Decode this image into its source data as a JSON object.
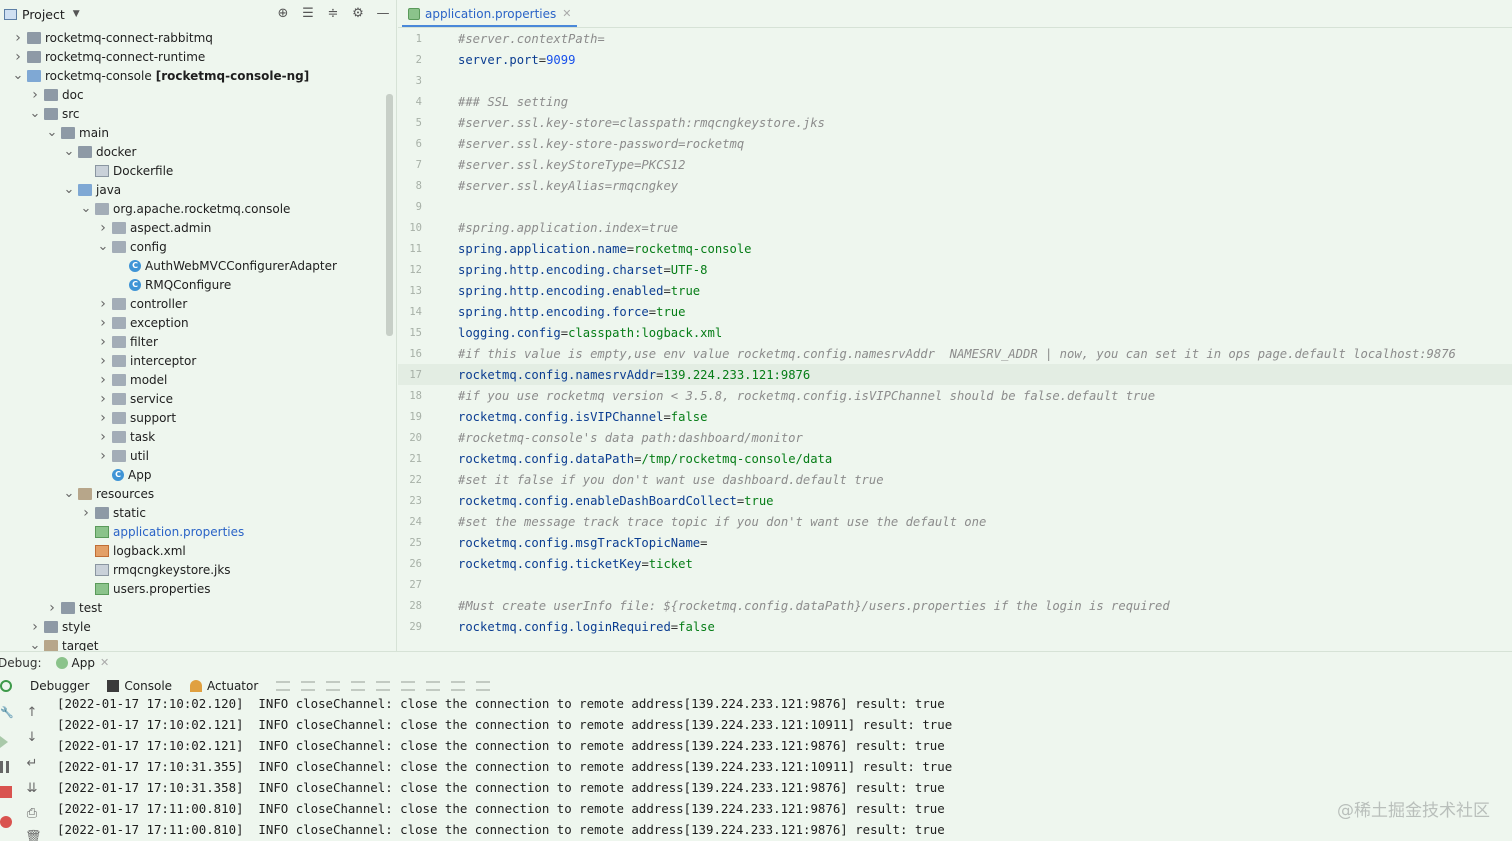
{
  "project": {
    "label": "Project",
    "tree": [
      {
        "label": "rocketmq-connect-rabbitmq",
        "depth": 0,
        "arrow": "right",
        "icon": "folder"
      },
      {
        "label": "rocketmq-connect-runtime",
        "depth": 0,
        "arrow": "right",
        "icon": "folder"
      },
      {
        "label": "rocketmq-console",
        "bold": "[rocketmq-console-ng]",
        "depth": 0,
        "arrow": "down",
        "icon": "module"
      },
      {
        "label": "doc",
        "depth": 1,
        "arrow": "right",
        "icon": "folder"
      },
      {
        "label": "src",
        "depth": 1,
        "arrow": "down",
        "icon": "folder"
      },
      {
        "label": "main",
        "depth": 2,
        "arrow": "down",
        "icon": "folder"
      },
      {
        "label": "docker",
        "depth": 3,
        "arrow": "down",
        "icon": "folder"
      },
      {
        "label": "Dockerfile",
        "depth": 4,
        "arrow": "",
        "icon": "file"
      },
      {
        "label": "java",
        "depth": 3,
        "arrow": "down",
        "icon": "folder-blue"
      },
      {
        "label": "org.apache.rocketmq.console",
        "depth": 4,
        "arrow": "down",
        "icon": "package"
      },
      {
        "label": "aspect.admin",
        "depth": 5,
        "arrow": "right",
        "icon": "package"
      },
      {
        "label": "config",
        "depth": 5,
        "arrow": "down",
        "icon": "package"
      },
      {
        "label": "AuthWebMVCConfigurerAdapter",
        "depth": 6,
        "arrow": "",
        "icon": "class"
      },
      {
        "label": "RMQConfigure",
        "depth": 6,
        "arrow": "",
        "icon": "class"
      },
      {
        "label": "controller",
        "depth": 5,
        "arrow": "right",
        "icon": "package"
      },
      {
        "label": "exception",
        "depth": 5,
        "arrow": "right",
        "icon": "package"
      },
      {
        "label": "filter",
        "depth": 5,
        "arrow": "right",
        "icon": "package"
      },
      {
        "label": "interceptor",
        "depth": 5,
        "arrow": "right",
        "icon": "package"
      },
      {
        "label": "model",
        "depth": 5,
        "arrow": "right",
        "icon": "package"
      },
      {
        "label": "service",
        "depth": 5,
        "arrow": "right",
        "icon": "package"
      },
      {
        "label": "support",
        "depth": 5,
        "arrow": "right",
        "icon": "package"
      },
      {
        "label": "task",
        "depth": 5,
        "arrow": "right",
        "icon": "package"
      },
      {
        "label": "util",
        "depth": 5,
        "arrow": "right",
        "icon": "package"
      },
      {
        "label": "App",
        "depth": 5,
        "arrow": "",
        "icon": "class"
      },
      {
        "label": "resources",
        "depth": 3,
        "arrow": "down",
        "icon": "folder-res"
      },
      {
        "label": "static",
        "depth": 4,
        "arrow": "right",
        "icon": "folder"
      },
      {
        "label": "application.properties",
        "depth": 4,
        "arrow": "",
        "icon": "props",
        "highlight": true
      },
      {
        "label": "logback.xml",
        "depth": 4,
        "arrow": "",
        "icon": "xml"
      },
      {
        "label": "rmqcngkeystore.jks",
        "depth": 4,
        "arrow": "",
        "icon": "file"
      },
      {
        "label": "users.properties",
        "depth": 4,
        "arrow": "",
        "icon": "props"
      },
      {
        "label": "test",
        "depth": 2,
        "arrow": "right",
        "icon": "folder"
      },
      {
        "label": "style",
        "depth": 1,
        "arrow": "right",
        "icon": "folder"
      },
      {
        "label": "target",
        "depth": 1,
        "arrow": "down",
        "icon": "folder-res"
      }
    ]
  },
  "editor": {
    "tab_label": "application.properties",
    "current_line": 17,
    "lines": [
      {
        "n": "1",
        "type": "comment",
        "text": "#server.contextPath="
      },
      {
        "n": "2",
        "type": "kv",
        "key": "server.port",
        "value": "9099",
        "vtype": "num"
      },
      {
        "n": "3",
        "type": "blank",
        "text": ""
      },
      {
        "n": "4",
        "type": "comment",
        "text": "### SSL setting"
      },
      {
        "n": "5",
        "type": "comment",
        "text": "#server.ssl.key-store=classpath:rmqcngkeystore.jks"
      },
      {
        "n": "6",
        "type": "comment",
        "text": "#server.ssl.key-store-password=rocketmq"
      },
      {
        "n": "7",
        "type": "comment",
        "text": "#server.ssl.keyStoreType=PKCS12"
      },
      {
        "n": "8",
        "type": "comment",
        "text": "#server.ssl.keyAlias=rmqcngkey"
      },
      {
        "n": "9",
        "type": "blank",
        "text": ""
      },
      {
        "n": "10",
        "type": "comment",
        "text": "#spring.application.index=true"
      },
      {
        "n": "11",
        "type": "kv",
        "key": "spring.application.name",
        "value": "rocketmq-console",
        "vtype": "val"
      },
      {
        "n": "12",
        "type": "kv",
        "key": "spring.http.encoding.charset",
        "value": "UTF-8",
        "vtype": "val"
      },
      {
        "n": "13",
        "type": "kv",
        "key": "spring.http.encoding.enabled",
        "value": "true",
        "vtype": "val"
      },
      {
        "n": "14",
        "type": "kv",
        "key": "spring.http.encoding.force",
        "value": "true",
        "vtype": "val"
      },
      {
        "n": "15",
        "type": "kv",
        "key": "logging.config",
        "value": "classpath:logback.xml",
        "vtype": "val"
      },
      {
        "n": "16",
        "type": "comment",
        "text": "#if this value is empty,use env value rocketmq.config.namesrvAddr  NAMESRV_ADDR | now, you can set it in ops page.default localhost:9876"
      },
      {
        "n": "17",
        "type": "kv",
        "key": "rocketmq.config.namesrvAddr",
        "value": "139.224.233.121:9876",
        "vtype": "val"
      },
      {
        "n": "18",
        "type": "comment",
        "text": "#if you use rocketmq version < 3.5.8, rocketmq.config.isVIPChannel should be false.default true"
      },
      {
        "n": "19",
        "type": "kv",
        "key": "rocketmq.config.isVIPChannel",
        "value": "false",
        "vtype": "val"
      },
      {
        "n": "20",
        "type": "comment",
        "text": "#rocketmq-console's data path:dashboard/monitor"
      },
      {
        "n": "21",
        "type": "kv",
        "key": "rocketmq.config.dataPath",
        "value": "/tmp/rocketmq-console/data",
        "vtype": "val"
      },
      {
        "n": "22",
        "type": "comment",
        "text": "#set it false if you don't want use dashboard.default true"
      },
      {
        "n": "23",
        "type": "kv",
        "key": "rocketmq.config.enableDashBoardCollect",
        "value": "true",
        "vtype": "val"
      },
      {
        "n": "24",
        "type": "comment",
        "text": "#set the message track trace topic if you don't want use the default one"
      },
      {
        "n": "25",
        "type": "kv",
        "key": "rocketmq.config.msgTrackTopicName",
        "value": "",
        "vtype": "val"
      },
      {
        "n": "26",
        "type": "kv",
        "key": "rocketmq.config.ticketKey",
        "value": "ticket",
        "vtype": "val"
      },
      {
        "n": "27",
        "type": "blank",
        "text": ""
      },
      {
        "n": "28",
        "type": "comment",
        "text": "#Must create userInfo file: ${rocketmq.config.dataPath}/users.properties if the login is required"
      },
      {
        "n": "29",
        "type": "kv",
        "key": "rocketmq.config.loginRequired",
        "value": "false",
        "vtype": "val"
      }
    ]
  },
  "debug": {
    "label": "Debug:",
    "run_tab": "App",
    "tabs": {
      "debugger": "Debugger",
      "console": "Console",
      "actuator": "Actuator"
    },
    "log_lines": [
      "[2022-01-17 17:10:02.120]  INFO closeChannel: close the connection to remote address[139.224.233.121:9876] result: true",
      "[2022-01-17 17:10:02.121]  INFO closeChannel: close the connection to remote address[139.224.233.121:10911] result: true",
      "[2022-01-17 17:10:02.121]  INFO closeChannel: close the connection to remote address[139.224.233.121:9876] result: true",
      "[2022-01-17 17:10:31.355]  INFO closeChannel: close the connection to remote address[139.224.233.121:10911] result: true",
      "[2022-01-17 17:10:31.358]  INFO closeChannel: close the connection to remote address[139.224.233.121:9876] result: true",
      "[2022-01-17 17:11:00.810]  INFO closeChannel: close the connection to remote address[139.224.233.121:9876] result: true",
      "[2022-01-17 17:11:00.810]  INFO closeChannel: close the connection to remote address[139.224.233.121:9876] result: true"
    ]
  },
  "watermark": "@稀土掘金技术社区",
  "colors": {
    "background": "#eef6ee",
    "accent": "#2a63c7",
    "comment": "#8c8c8c",
    "key": "#0b3d91",
    "value": "#067d17",
    "number": "#1750eb"
  }
}
